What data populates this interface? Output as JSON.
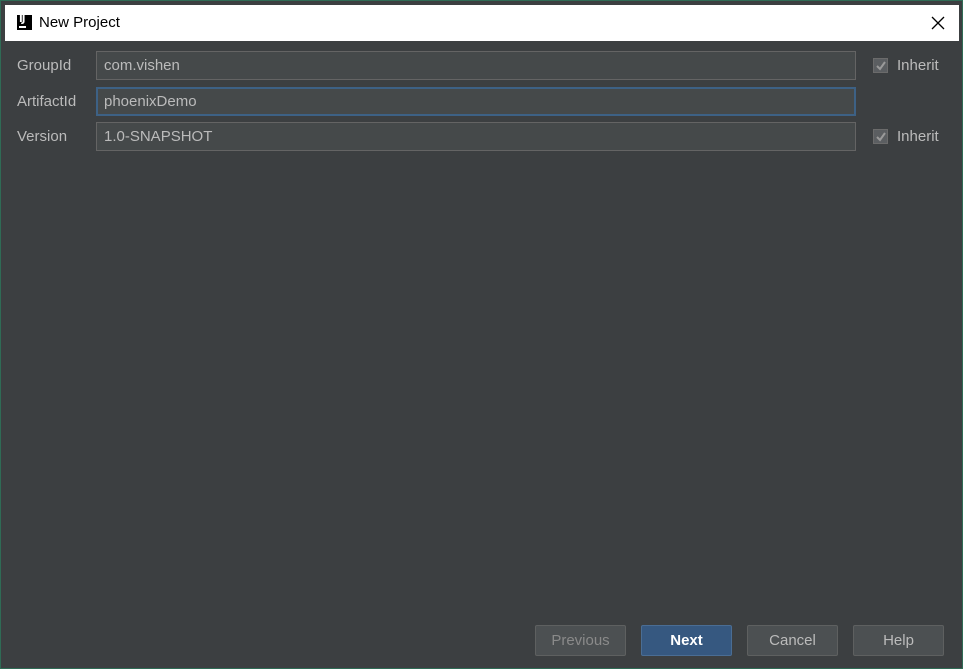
{
  "window": {
    "title": "New Project",
    "app_icon": "intellij-idea-icon",
    "close_icon": "close-icon"
  },
  "form": {
    "group_id": {
      "label": "GroupId",
      "value": "com.vishen",
      "inherit": true,
      "inherit_label": "Inherit"
    },
    "artifact_id": {
      "label": "ArtifactId",
      "value": "phoenixDemo"
    },
    "version": {
      "label": "Version",
      "value": "1.0-SNAPSHOT",
      "inherit": true,
      "inherit_label": "Inherit"
    }
  },
  "footer": {
    "previous_label": "Previous",
    "next_label": "Next",
    "cancel_label": "Cancel",
    "help_label": "Help"
  },
  "colors": {
    "background": "#3c3f41",
    "field_bg": "#45494a",
    "focus_border": "#3d6185",
    "primary_button": "#365880"
  }
}
